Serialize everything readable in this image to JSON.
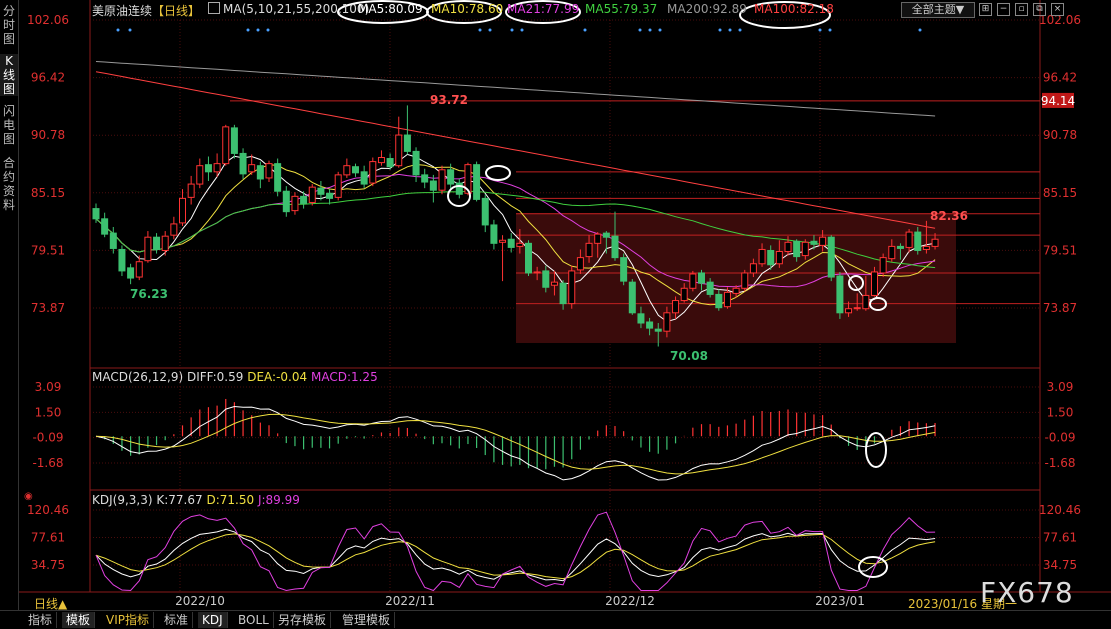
{
  "left_tabs": [
    {
      "label": "分时图",
      "active": false
    },
    {
      "label": "K线图",
      "active": true
    },
    {
      "label": "闪电图",
      "active": false
    },
    {
      "label": "合约资料",
      "active": false
    }
  ],
  "header": {
    "title": "美原油连续",
    "period": "【日线】",
    "ma_params": "MA(5,10,21,55,200,100)",
    "ma5": "MA5:80.09",
    "ma10": "MA10:78.60",
    "ma21": "MA21:77.99",
    "ma55": "MA55:79.37",
    "ma200": "MA200:92.89",
    "ma100": "MA100:82.18",
    "theme_select": "全部主题▼",
    "colors": {
      "ma5": "#ffffff",
      "ma10": "#f0e040",
      "ma21": "#e040e0",
      "ma55": "#40d040",
      "ma200": "#999999",
      "ma100": "#ff4040"
    }
  },
  "price_axis": {
    "ticks": [
      "102.06",
      "96.42",
      "90.78",
      "85.15",
      "79.51",
      "73.87"
    ],
    "tag_right": "94.14"
  },
  "annotations": {
    "high": "93.72",
    "low_left": "76.23",
    "low_mid": "70.08",
    "last_high": "82.36"
  },
  "macd": {
    "title": "MACD(26,12,9)",
    "diff": "DIFF:0.59",
    "dea": "DEA:-0.04",
    "macd": "MACD:1.25",
    "ticks": [
      "3.09",
      "1.50",
      "-0.09",
      "-1.68"
    ]
  },
  "kdj": {
    "title": "KDJ(9,3,3)",
    "k": "K:77.67",
    "d": "D:71.50",
    "j": "J:89.99",
    "ticks": [
      "120.46",
      "77.61",
      "34.75"
    ]
  },
  "x_axis": {
    "labels": [
      "2022/10",
      "2022/11",
      "2022/12",
      "2023/01"
    ],
    "current": "2023/01/16 星期一"
  },
  "period_label": "日线▲",
  "bottom_tabs": [
    {
      "label": "指标",
      "active": false,
      "vip": false
    },
    {
      "label": "模板",
      "active": true,
      "vip": false
    },
    {
      "label": "VIP指标",
      "active": false,
      "vip": true
    },
    {
      "label": "标准",
      "active": false,
      "vip": false
    },
    {
      "label": "KDJ",
      "active": true,
      "vip": false
    },
    {
      "label": "BOLL",
      "active": false,
      "vip": false
    },
    {
      "label": "另存模板",
      "active": false,
      "vip": false
    },
    {
      "label": "管理模板",
      "active": false,
      "vip": false
    }
  ],
  "watermark": "FX678",
  "chart_data": {
    "type": "candlestick",
    "price_range": [
      70.08,
      102.06
    ],
    "candles": [
      [
        83.6,
        82.6,
        84.1,
        82.2
      ],
      [
        82.6,
        81.1,
        83.2,
        80.8
      ],
      [
        81.2,
        79.7,
        81.8,
        79.2
      ],
      [
        79.6,
        77.5,
        80.0,
        77.0
      ],
      [
        77.8,
        76.8,
        78.2,
        76.2
      ],
      [
        76.9,
        78.4,
        79.0,
        76.6
      ],
      [
        78.5,
        80.8,
        81.4,
        78.3
      ],
      [
        80.8,
        79.6,
        81.2,
        79.2
      ],
      [
        79.5,
        80.9,
        81.4,
        79.0
      ],
      [
        81.0,
        82.1,
        82.8,
        80.6
      ],
      [
        82.2,
        84.6,
        85.5,
        81.9
      ],
      [
        84.7,
        86.0,
        86.8,
        84.0
      ],
      [
        86.0,
        87.8,
        88.5,
        85.6
      ],
      [
        87.9,
        87.2,
        88.7,
        86.3
      ],
      [
        87.2,
        88.0,
        89.0,
        86.7
      ],
      [
        88.0,
        91.6,
        91.8,
        87.8
      ],
      [
        91.5,
        89.0,
        91.8,
        88.5
      ],
      [
        89.0,
        87.0,
        89.5,
        86.5
      ],
      [
        87.2,
        87.9,
        88.9,
        86.9
      ],
      [
        87.8,
        86.5,
        88.2,
        85.6
      ],
      [
        86.6,
        88.0,
        88.3,
        86.2
      ],
      [
        88.0,
        85.3,
        88.5,
        84.8
      ],
      [
        85.3,
        83.3,
        85.8,
        82.8
      ],
      [
        83.4,
        84.8,
        85.2,
        83.0
      ],
      [
        84.8,
        84.1,
        85.3,
        83.6
      ],
      [
        84.2,
        85.7,
        86.0,
        83.9
      ],
      [
        85.6,
        85.0,
        86.3,
        84.4
      ],
      [
        85.1,
        84.6,
        85.5,
        84.0
      ],
      [
        84.7,
        86.9,
        87.2,
        84.4
      ],
      [
        86.9,
        87.8,
        88.5,
        86.6
      ],
      [
        87.7,
        87.1,
        88.0,
        86.7
      ],
      [
        87.2,
        86.0,
        87.8,
        85.6
      ],
      [
        86.1,
        88.2,
        88.6,
        85.8
      ],
      [
        88.1,
        88.6,
        89.3,
        87.8
      ],
      [
        88.5,
        87.7,
        89.0,
        87.4
      ],
      [
        87.8,
        90.8,
        92.6,
        87.6
      ],
      [
        90.8,
        89.2,
        93.7,
        88.9
      ],
      [
        89.2,
        86.9,
        89.6,
        86.2
      ],
      [
        86.9,
        86.2,
        87.5,
        85.6
      ],
      [
        86.3,
        85.4,
        86.9,
        84.2
      ],
      [
        85.4,
        87.4,
        87.8,
        85.0
      ],
      [
        87.4,
        86.0,
        88.0,
        85.5
      ],
      [
        86.1,
        85.0,
        86.5,
        84.6
      ],
      [
        85.1,
        87.9,
        88.1,
        84.9
      ],
      [
        87.9,
        84.5,
        88.2,
        84.3
      ],
      [
        84.6,
        82.0,
        85.0,
        81.3
      ],
      [
        82.0,
        80.2,
        82.5,
        79.6
      ],
      [
        80.3,
        80.5,
        81.0,
        76.5
      ],
      [
        80.6,
        79.8,
        81.2,
        79.3
      ],
      [
        79.9,
        80.2,
        81.6,
        79.2
      ],
      [
        80.2,
        77.3,
        80.5,
        77.0
      ],
      [
        77.3,
        77.4,
        77.9,
        76.6
      ],
      [
        77.5,
        75.9,
        78.0,
        75.4
      ],
      [
        76.1,
        76.4,
        77.5,
        75.1
      ],
      [
        76.3,
        74.3,
        76.6,
        73.7
      ],
      [
        74.3,
        77.5,
        78.0,
        73.8
      ],
      [
        77.6,
        78.8,
        79.6,
        77.2
      ],
      [
        78.9,
        80.2,
        81.0,
        78.3
      ],
      [
        80.2,
        81.1,
        81.3,
        78.8
      ],
      [
        81.2,
        80.8,
        81.4,
        79.2
      ],
      [
        80.9,
        78.8,
        83.3,
        78.5
      ],
      [
        78.8,
        76.5,
        79.2,
        76.1
      ],
      [
        76.4,
        73.4,
        76.7,
        73.2
      ],
      [
        73.3,
        72.4,
        74.0,
        71.9
      ],
      [
        72.5,
        71.9,
        72.9,
        71.2
      ],
      [
        71.8,
        71.6,
        72.4,
        70.1
      ],
      [
        71.6,
        73.4,
        74.0,
        71.0
      ],
      [
        73.4,
        74.6,
        75.0,
        72.8
      ],
      [
        74.6,
        75.8,
        76.3,
        74.4
      ],
      [
        75.8,
        77.2,
        77.5,
        75.5
      ],
      [
        77.3,
        76.3,
        77.6,
        75.6
      ],
      [
        76.4,
        75.2,
        76.8,
        74.9
      ],
      [
        75.2,
        73.9,
        75.7,
        73.6
      ],
      [
        74.0,
        75.4,
        75.9,
        73.8
      ],
      [
        75.3,
        75.8,
        76.1,
        74.9
      ],
      [
        75.8,
        77.3,
        77.6,
        75.5
      ],
      [
        77.3,
        78.2,
        78.7,
        76.9
      ],
      [
        78.2,
        79.6,
        80.2,
        77.9
      ],
      [
        79.5,
        78.1,
        80.0,
        77.6
      ],
      [
        78.2,
        79.4,
        80.5,
        77.8
      ],
      [
        79.4,
        80.3,
        80.9,
        79.0
      ],
      [
        80.4,
        78.9,
        80.6,
        78.4
      ],
      [
        79.0,
        80.3,
        80.6,
        78.6
      ],
      [
        80.4,
        80.1,
        81.0,
        79.6
      ],
      [
        80.0,
        80.8,
        81.5,
        79.4
      ],
      [
        80.8,
        76.9,
        81.0,
        76.5
      ],
      [
        77.0,
        73.4,
        77.4,
        72.8
      ],
      [
        73.4,
        73.8,
        74.5,
        73.0
      ],
      [
        73.9,
        73.9,
        75.3,
        73.6
      ],
      [
        73.8,
        75.1,
        77.0,
        73.6
      ],
      [
        75.1,
        77.4,
        77.9,
        75.0
      ],
      [
        77.3,
        78.8,
        79.2,
        76.9
      ],
      [
        78.7,
        79.9,
        80.6,
        78.4
      ],
      [
        79.9,
        79.7,
        80.2,
        78.6
      ],
      [
        79.8,
        81.3,
        81.6,
        79.3
      ],
      [
        81.3,
        79.5,
        81.8,
        79.1
      ],
      [
        79.6,
        79.9,
        82.4,
        79.2
      ],
      [
        79.9,
        80.6,
        81.2,
        79.6
      ]
    ],
    "ma_lines": [
      "MA5",
      "MA10",
      "MA21",
      "MA55",
      "MA200",
      "MA100"
    ]
  }
}
